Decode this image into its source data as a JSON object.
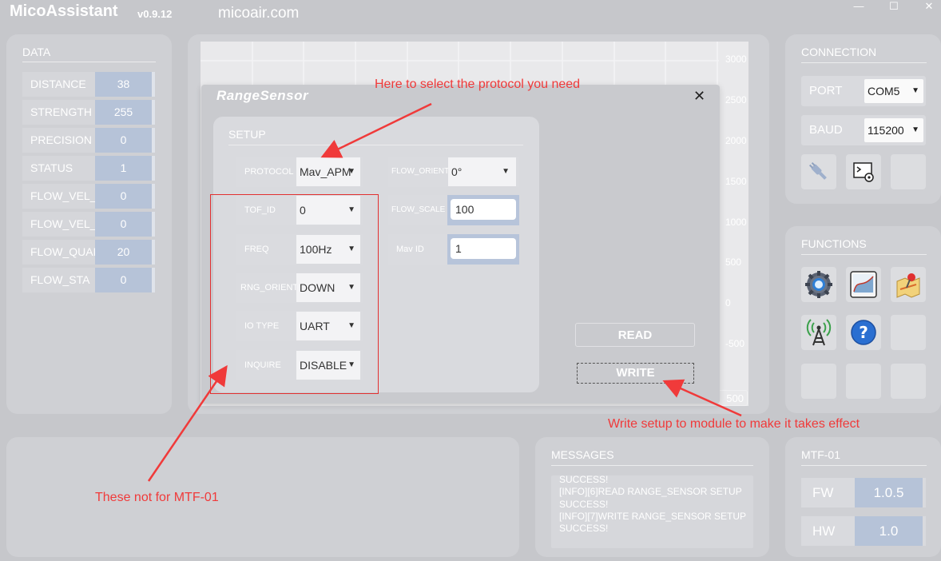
{
  "app": {
    "title": "MicoAssistant",
    "version": "v0.9.12",
    "site": "micoair.com"
  },
  "window_controls": {
    "minimize": "—",
    "maximize": "☐",
    "close": "✕"
  },
  "data_panel": {
    "title": "DATA",
    "rows": [
      {
        "label": "DISTANCE",
        "value": "38"
      },
      {
        "label": "STRENGTH",
        "value": "255"
      },
      {
        "label": "PRECISION",
        "value": "0"
      },
      {
        "label": "STATUS",
        "value": "1"
      },
      {
        "label": "FLOW_VEL_X",
        "value": "0"
      },
      {
        "label": "FLOW_VEL_Y",
        "value": "0"
      },
      {
        "label": "FLOW_QUAL",
        "value": "20"
      },
      {
        "label": "FLOW_STA",
        "value": "0"
      }
    ]
  },
  "chart": {
    "y_ticks": [
      "3000",
      "2500",
      "2000",
      "1500",
      "1000",
      "500",
      "0",
      "-500"
    ],
    "bottom_value": "500"
  },
  "modal": {
    "title": "RangeSensor",
    "close": "✕",
    "setup_title": "SETUP",
    "left_fields": [
      {
        "label": "PROTOCOL",
        "value": "Mav_APM"
      },
      {
        "label": "TOF_ID",
        "value": "0"
      },
      {
        "label": "FREQ",
        "value": "100Hz"
      },
      {
        "label": "RNG_ORIENT",
        "value": "DOWN"
      },
      {
        "label": "IO TYPE",
        "value": "UART"
      },
      {
        "label": "INQUIRE",
        "value": "DISABLE"
      }
    ],
    "flow_orient": {
      "label": "FLOW_ORIENT",
      "value": "0°"
    },
    "flow_scale": {
      "label": "FLOW_SCALE",
      "value": "100"
    },
    "mav_id": {
      "label": "Mav ID",
      "value": "1"
    },
    "read_button": "READ",
    "write_button": "WRITE"
  },
  "connection": {
    "title": "CONNECTION",
    "port": {
      "label": "PORT",
      "value": "COM5"
    },
    "baud": {
      "label": "BAUD",
      "value": "115200"
    }
  },
  "functions": {
    "title": "FUNCTIONS"
  },
  "messages": {
    "title": "MESSAGES",
    "lines": [
      "SUCCESS!",
      "[INFO][6]READ RANGE_SENSOR SETUP",
      "SUCCESS!",
      "[INFO][7]WRITE RANGE_SENSOR SETUP",
      "SUCCESS!"
    ]
  },
  "mtf": {
    "title": "MTF-01",
    "fw": {
      "label": "FW",
      "value": "1.0.5"
    },
    "hw": {
      "label": "HW",
      "value": "1.0"
    }
  },
  "annotations": {
    "protocol": "Here to select the protocol you need",
    "write": "Write setup to module to make it takes effect",
    "not_for": "These not for MTF-01"
  },
  "colors": {
    "annotation": "#f03a3a",
    "value_bg": "#b6c3d8"
  },
  "icons": [
    "dropdown-arrow-icon",
    "plug-icon",
    "terminal-settings-icon",
    "settings-gear-icon",
    "chart-icon",
    "map-pin-icon",
    "antenna-icon",
    "help-icon",
    "close-icon"
  ]
}
